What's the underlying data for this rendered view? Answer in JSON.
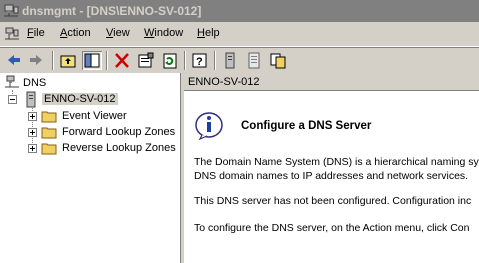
{
  "window": {
    "title": "dnsmgmt - [DNS\\ENNO-SV-012]"
  },
  "menu": {
    "file": "File",
    "action": "Action",
    "view": "View",
    "window": "Window",
    "help": "Help"
  },
  "toolbar": {
    "buttons": [
      "back-icon",
      "forward-icon",
      "up-one-level-icon",
      "show-hide-console-tree-icon",
      "delete-icon",
      "properties-icon",
      "refresh-icon",
      "help-icon",
      "server-icon",
      "document-icon",
      "zones-icon"
    ]
  },
  "tree": {
    "root": "DNS",
    "server": "ENNO-SV-012",
    "children": [
      "Event Viewer",
      "Forward Lookup Zones",
      "Reverse Lookup Zones"
    ]
  },
  "right": {
    "header": "ENNO-SV-012",
    "title": "Configure a DNS Server",
    "paragraphs": [
      "The Domain Name System (DNS) is a hierarchical naming sys",
      "DNS domain names to IP addresses and network services.",
      "This DNS server has not been configured. Configuration inc",
      "To configure the DNS server, on the Action menu, click Con"
    ]
  },
  "colors": {
    "titlebar_inactive": "#808080",
    "face": "#d4d0c8"
  }
}
